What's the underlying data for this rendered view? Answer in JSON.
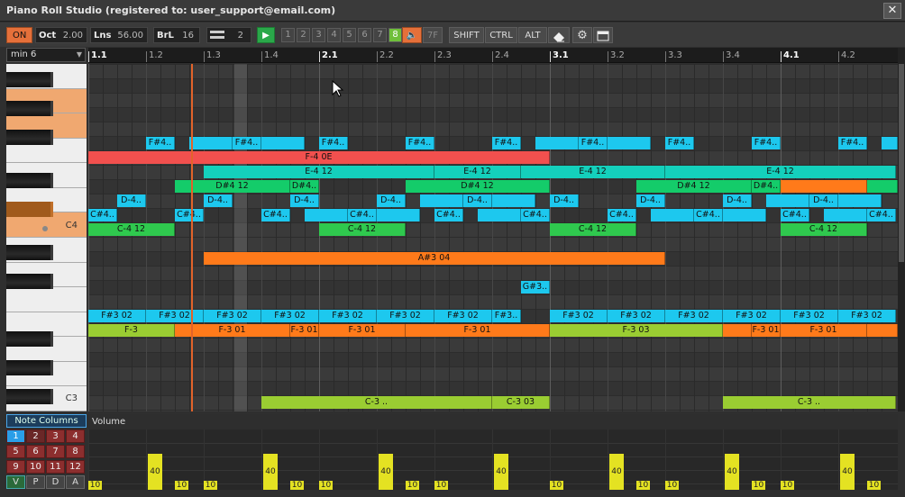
{
  "window": {
    "title": "Piano Roll Studio  (registered to: user_support@email.com)",
    "close_glyph": "✕"
  },
  "toolbar": {
    "on_label": "ON",
    "oct_label": "Oct",
    "oct_value": "2.00",
    "lns_label": "Lns",
    "lns_value": "56.00",
    "brl_label": "BrL",
    "brl_value": "16",
    "pattern_value": "2",
    "play_glyph": "▶",
    "tracks": [
      "1",
      "2",
      "3",
      "4",
      "5",
      "6",
      "7",
      "8"
    ],
    "active_track": "8",
    "mute_glyph": "🔈",
    "fx_label": "7F",
    "shift_label": "SHIFT",
    "ctrl_label": "CTRL",
    "alt_label": "ALT",
    "gear_glyph": "⚙"
  },
  "scale_select": {
    "value": "min 6",
    "arrow": "▼"
  },
  "ruler": {
    "labels": [
      "1.1",
      "1.2",
      "1.3",
      "1.4",
      "2.1",
      "2.2",
      "2.3",
      "2.4",
      "3.1",
      "3.2",
      "3.3",
      "3.4",
      "4.1",
      "4.2"
    ],
    "bar_labels": [
      "1.1",
      "2.1",
      "3.1",
      "4.1"
    ]
  },
  "keyboard": {
    "c4_label": "C4",
    "c3_label": "C3"
  },
  "notes": [
    {
      "label": "F#4..",
      "row": 5,
      "start": 64,
      "width": 32,
      "color": "cyan"
    },
    {
      "label": "",
      "row": 5,
      "start": 112,
      "width": 48,
      "color": "cyan"
    },
    {
      "label": "F#4..",
      "row": 5,
      "start": 160,
      "width": 32,
      "color": "cyan"
    },
    {
      "label": "",
      "row": 5,
      "start": 192,
      "width": 48,
      "color": "cyan"
    },
    {
      "label": "F#4..",
      "row": 5,
      "start": 256,
      "width": 32,
      "color": "cyan"
    },
    {
      "label": "F#4..",
      "row": 5,
      "start": 352,
      "width": 32,
      "color": "cyan"
    },
    {
      "label": "F#4..",
      "row": 5,
      "start": 448,
      "width": 32,
      "color": "cyan"
    },
    {
      "label": "",
      "row": 5,
      "start": 496,
      "width": 48,
      "color": "cyan"
    },
    {
      "label": "F#4..",
      "row": 5,
      "start": 544,
      "width": 32,
      "color": "cyan"
    },
    {
      "label": "",
      "row": 5,
      "start": 576,
      "width": 48,
      "color": "cyan"
    },
    {
      "label": "F#4..",
      "row": 5,
      "start": 640,
      "width": 32,
      "color": "cyan"
    },
    {
      "label": "F#4..",
      "row": 5,
      "start": 736,
      "width": 32,
      "color": "cyan"
    },
    {
      "label": "F#4..",
      "row": 5,
      "start": 832,
      "width": 32,
      "color": "cyan"
    },
    {
      "label": "",
      "row": 5,
      "start": 880,
      "width": 18,
      "color": "cyan"
    },
    {
      "label": "F-4 0E",
      "row": 6,
      "start": 0,
      "width": 512,
      "color": "red"
    },
    {
      "label": "E-4 12",
      "row": 7,
      "start": 128,
      "width": 256,
      "color": "teal"
    },
    {
      "label": "E-4 12",
      "row": 7,
      "start": 384,
      "width": 96,
      "color": "teal"
    },
    {
      "label": "E-4 12",
      "row": 7,
      "start": 480,
      "width": 160,
      "color": "teal"
    },
    {
      "label": "E-4 12",
      "row": 7,
      "start": 640,
      "width": 256,
      "color": "teal"
    },
    {
      "label": "D#4 12",
      "row": 8,
      "start": 96,
      "width": 128,
      "color": "green"
    },
    {
      "label": "D#4..",
      "row": 8,
      "start": 224,
      "width": 32,
      "color": "green"
    },
    {
      "label": "D#4 12",
      "row": 8,
      "start": 352,
      "width": 160,
      "color": "green"
    },
    {
      "label": "D#4 12",
      "row": 8,
      "start": 608,
      "width": 128,
      "color": "green"
    },
    {
      "label": "D#4..",
      "row": 8,
      "start": 736,
      "width": 32,
      "color": "green"
    },
    {
      "label": "",
      "row": 8,
      "start": 768,
      "width": 96,
      "color": "orange"
    },
    {
      "label": "",
      "row": 8,
      "start": 864,
      "width": 34,
      "color": "green"
    },
    {
      "label": "D-4..",
      "row": 9,
      "start": 32,
      "width": 32,
      "color": "cyan"
    },
    {
      "label": "D-4..",
      "row": 9,
      "start": 128,
      "width": 32,
      "color": "cyan"
    },
    {
      "label": "D-4..",
      "row": 9,
      "start": 224,
      "width": 32,
      "color": "cyan"
    },
    {
      "label": "D-4..",
      "row": 9,
      "start": 320,
      "width": 32,
      "color": "cyan"
    },
    {
      "label": "",
      "row": 9,
      "start": 368,
      "width": 48,
      "color": "cyan"
    },
    {
      "label": "D-4..",
      "row": 9,
      "start": 416,
      "width": 32,
      "color": "cyan"
    },
    {
      "label": "",
      "row": 9,
      "start": 448,
      "width": 48,
      "color": "cyan"
    },
    {
      "label": "D-4..",
      "row": 9,
      "start": 512,
      "width": 32,
      "color": "cyan"
    },
    {
      "label": "D-4..",
      "row": 9,
      "start": 608,
      "width": 32,
      "color": "cyan"
    },
    {
      "label": "D-4..",
      "row": 9,
      "start": 704,
      "width": 32,
      "color": "cyan"
    },
    {
      "label": "",
      "row": 9,
      "start": 752,
      "width": 48,
      "color": "cyan"
    },
    {
      "label": "D-4..",
      "row": 9,
      "start": 800,
      "width": 32,
      "color": "cyan"
    },
    {
      "label": "",
      "row": 9,
      "start": 832,
      "width": 48,
      "color": "cyan"
    },
    {
      "label": "C#4..",
      "row": 10,
      "start": 0,
      "width": 32,
      "color": "cyan"
    },
    {
      "label": "C#4..",
      "row": 10,
      "start": 96,
      "width": 32,
      "color": "cyan"
    },
    {
      "label": "C#4..",
      "row": 10,
      "start": 192,
      "width": 32,
      "color": "cyan"
    },
    {
      "label": "",
      "row": 10,
      "start": 240,
      "width": 48,
      "color": "cyan"
    },
    {
      "label": "C#4..",
      "row": 10,
      "start": 288,
      "width": 32,
      "color": "cyan"
    },
    {
      "label": "",
      "row": 10,
      "start": 320,
      "width": 48,
      "color": "cyan"
    },
    {
      "label": "C#4..",
      "row": 10,
      "start": 384,
      "width": 32,
      "color": "cyan"
    },
    {
      "label": "",
      "row": 10,
      "start": 432,
      "width": 48,
      "color": "cyan"
    },
    {
      "label": "C#4..",
      "row": 10,
      "start": 480,
      "width": 32,
      "color": "cyan"
    },
    {
      "label": "C#4..",
      "row": 10,
      "start": 576,
      "width": 32,
      "color": "cyan"
    },
    {
      "label": "",
      "row": 10,
      "start": 624,
      "width": 48,
      "color": "cyan"
    },
    {
      "label": "C#4..",
      "row": 10,
      "start": 672,
      "width": 32,
      "color": "cyan"
    },
    {
      "label": "",
      "row": 10,
      "start": 704,
      "width": 48,
      "color": "cyan"
    },
    {
      "label": "C#4..",
      "row": 10,
      "start": 768,
      "width": 32,
      "color": "cyan"
    },
    {
      "label": "",
      "row": 10,
      "start": 816,
      "width": 48,
      "color": "cyan"
    },
    {
      "label": "C#4..",
      "row": 10,
      "start": 864,
      "width": 32,
      "color": "cyan"
    },
    {
      "label": "C-4 12",
      "row": 11,
      "start": 0,
      "width": 96,
      "color": "green2"
    },
    {
      "label": "C-4 12",
      "row": 11,
      "start": 256,
      "width": 96,
      "color": "green2"
    },
    {
      "label": "C-4 12",
      "row": 11,
      "start": 512,
      "width": 96,
      "color": "green2"
    },
    {
      "label": "C-4 12",
      "row": 11,
      "start": 768,
      "width": 96,
      "color": "green2"
    },
    {
      "label": "A#3 04",
      "row": 13,
      "start": 128,
      "width": 512,
      "color": "orange"
    },
    {
      "label": "G#3..",
      "row": 15,
      "start": 480,
      "width": 32,
      "color": "cyan"
    },
    {
      "label": "F#3 02",
      "row": 17,
      "start": 0,
      "width": 64,
      "color": "cyan"
    },
    {
      "label": "F#3 02",
      "row": 17,
      "start": 64,
      "width": 64,
      "color": "cyan"
    },
    {
      "label": "F#3 02",
      "row": 17,
      "start": 128,
      "width": 64,
      "color": "cyan"
    },
    {
      "label": "F#3 02",
      "row": 17,
      "start": 192,
      "width": 64,
      "color": "cyan"
    },
    {
      "label": "F#3 02",
      "row": 17,
      "start": 256,
      "width": 64,
      "color": "cyan"
    },
    {
      "label": "F#3 02",
      "row": 17,
      "start": 320,
      "width": 64,
      "color": "cyan"
    },
    {
      "label": "F#3 02",
      "row": 17,
      "start": 384,
      "width": 64,
      "color": "cyan"
    },
    {
      "label": "F#3..",
      "row": 17,
      "start": 448,
      "width": 32,
      "color": "cyan"
    },
    {
      "label": "F#3 02",
      "row": 17,
      "start": 512,
      "width": 64,
      "color": "cyan"
    },
    {
      "label": "F#3 02",
      "row": 17,
      "start": 576,
      "width": 64,
      "color": "cyan"
    },
    {
      "label": "F#3 02",
      "row": 17,
      "start": 640,
      "width": 64,
      "color": "cyan"
    },
    {
      "label": "F#3 02",
      "row": 17,
      "start": 704,
      "width": 64,
      "color": "cyan"
    },
    {
      "label": "F#3 02",
      "row": 17,
      "start": 768,
      "width": 64,
      "color": "cyan"
    },
    {
      "label": "F#3 02",
      "row": 17,
      "start": 832,
      "width": 64,
      "color": "cyan"
    },
    {
      "label": "F-3",
      "row": 18,
      "start": 0,
      "width": 96,
      "color": "lime"
    },
    {
      "label": "F-3 01",
      "row": 18,
      "start": 96,
      "width": 128,
      "color": "orange"
    },
    {
      "label": "F-3 01",
      "row": 18,
      "start": 224,
      "width": 32,
      "color": "orange"
    },
    {
      "label": "F-3 01",
      "row": 18,
      "start": 256,
      "width": 96,
      "color": "orange"
    },
    {
      "label": "F-3 01",
      "row": 18,
      "start": 352,
      "width": 160,
      "color": "orange"
    },
    {
      "label": "F-3 03",
      "row": 18,
      "start": 512,
      "width": 192,
      "color": "lime"
    },
    {
      "label": "",
      "row": 18,
      "start": 704,
      "width": 32,
      "color": "orange"
    },
    {
      "label": "F-3 01",
      "row": 18,
      "start": 736,
      "width": 32,
      "color": "orange"
    },
    {
      "label": "F-3 01",
      "row": 18,
      "start": 768,
      "width": 96,
      "color": "orange"
    },
    {
      "label": "",
      "row": 18,
      "start": 864,
      "width": 34,
      "color": "orange"
    },
    {
      "label": "C-3 ..",
      "row": 23,
      "start": 192,
      "width": 256,
      "color": "lime"
    },
    {
      "label": "C-3 03",
      "row": 23,
      "start": 448,
      "width": 64,
      "color": "lime"
    },
    {
      "label": "C-3 ..",
      "row": 23,
      "start": 704,
      "width": 192,
      "color": "lime"
    }
  ],
  "note_columns": {
    "title": "Note Columns",
    "buttons": [
      "1",
      "2",
      "3",
      "4",
      "5",
      "6",
      "7",
      "8",
      "9",
      "10",
      "11",
      "12"
    ],
    "active": "1",
    "modes": [
      "V",
      "P",
      "D",
      "A"
    ],
    "active_mode": "V"
  },
  "volume": {
    "label": "Volume",
    "bars": [
      {
        "t": 0,
        "v": "10"
      },
      {
        "t": 64,
        "v": "40"
      },
      {
        "t": 96,
        "v": "10"
      },
      {
        "t": 128,
        "v": "10"
      },
      {
        "t": 192,
        "v": "40"
      },
      {
        "t": 224,
        "v": "10"
      },
      {
        "t": 256,
        "v": "10"
      },
      {
        "t": 320,
        "v": "40"
      },
      {
        "t": 352,
        "v": "10"
      },
      {
        "t": 384,
        "v": "10"
      },
      {
        "t": 448,
        "v": "40"
      },
      {
        "t": 512,
        "v": "10"
      },
      {
        "t": 576,
        "v": "40"
      },
      {
        "t": 608,
        "v": "10"
      },
      {
        "t": 640,
        "v": "10"
      },
      {
        "t": 704,
        "v": "40"
      },
      {
        "t": 736,
        "v": "10"
      },
      {
        "t": 768,
        "v": "10"
      },
      {
        "t": 832,
        "v": "40"
      },
      {
        "t": 864,
        "v": "10"
      }
    ]
  },
  "colors": {
    "cyan": "#1dc8ee",
    "red": "#f2504e",
    "teal": "#14d0bc",
    "green": "#14cc6a",
    "orange": "#ff7a1a",
    "lime": "#9acd32",
    "green2": "#2fc94e",
    "accent": "#e5703a"
  }
}
